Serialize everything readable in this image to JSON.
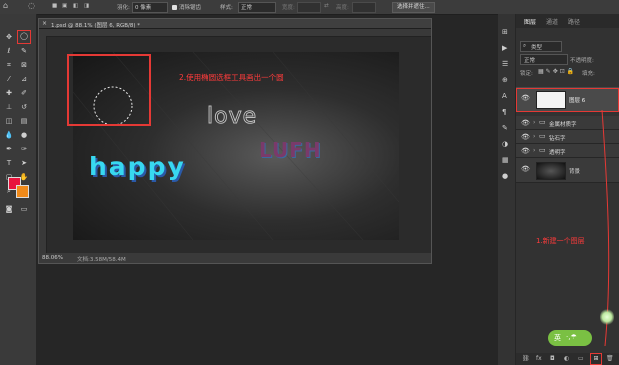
{
  "options_bar": {
    "feather_label": "羽化:",
    "feather_value": "0 像素",
    "antialias_label": "消除锯齿",
    "style_label": "样式:",
    "style_value": "正常",
    "width_label": "宽度:",
    "height_label": "高度:",
    "select_mask_button": "选择并遮住..."
  },
  "document": {
    "tab_title": "1.psd @ 88.1% (图层 6, RGB/8) *",
    "zoom": "88.06%",
    "doc_info": "文档:3.58M/58.4M",
    "canvas_text_love": "love",
    "canvas_text_happy": "happy",
    "canvas_text_lufh": "LUFH"
  },
  "annotations": {
    "step2": "2.使用椭圆选框工具画出一个圆",
    "step1": "1.新建一个图层"
  },
  "layers_panel": {
    "tabs": [
      "图层",
      "通道",
      "路径"
    ],
    "filter_kind": "类型",
    "blend_mode": "正常",
    "opacity_label": "不透明度:",
    "lock_label": "锁定:",
    "fill_label": "填充:",
    "layers": [
      {
        "name": "图层 6",
        "type": "layer"
      },
      {
        "name": "金属材质字",
        "type": "group"
      },
      {
        "name": "钻石字",
        "type": "group"
      },
      {
        "name": "透明字",
        "type": "group"
      },
      {
        "name": "背景",
        "type": "layer"
      }
    ],
    "footer_fx": "fx"
  },
  "ime": {
    "label": "英"
  },
  "colors": {
    "foreground": "#e8143c",
    "background": "#f08a1a",
    "annotation_red": "#e53935",
    "happy_cyan": "#38d8f0"
  }
}
